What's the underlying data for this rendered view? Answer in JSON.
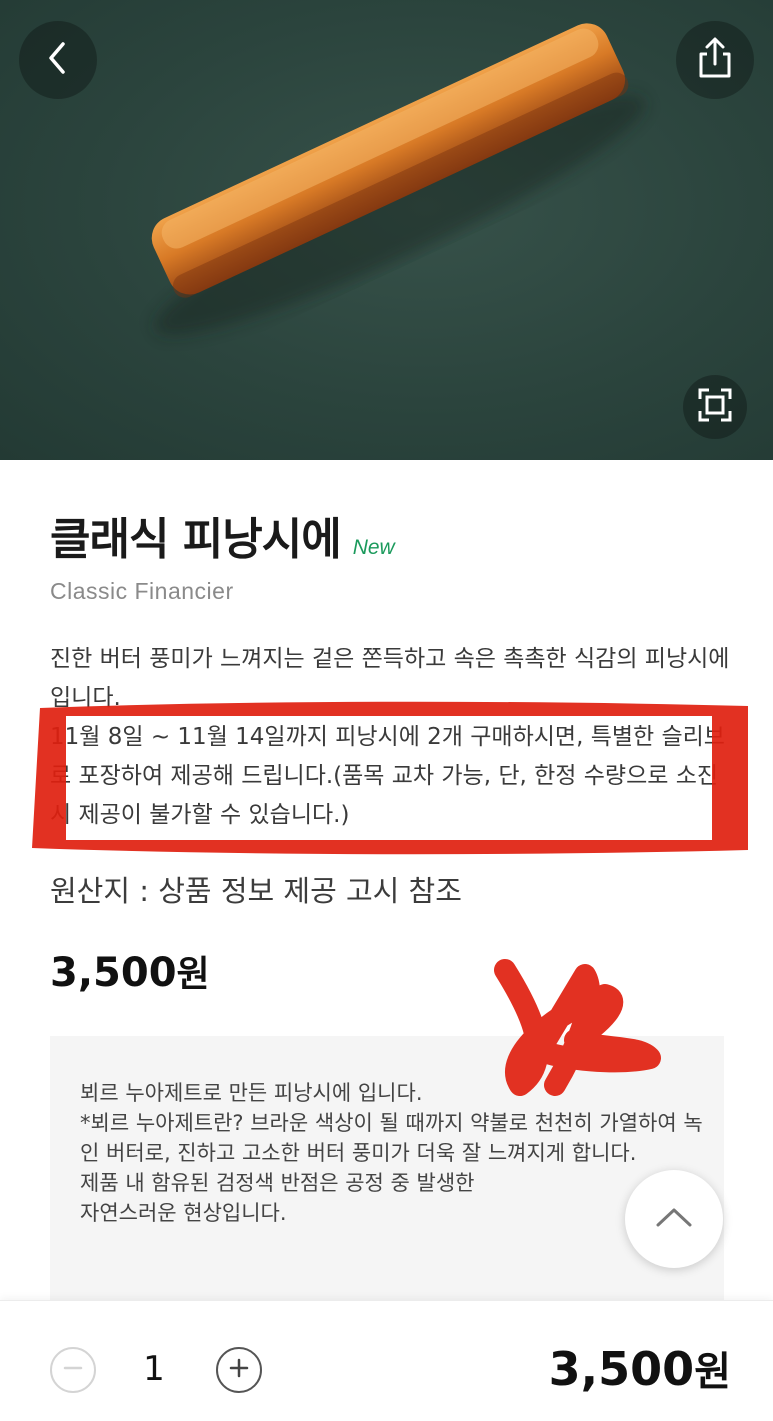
{
  "product": {
    "name": "클래식 피낭시에",
    "badge": "New",
    "english_name": "Classic Financier",
    "description": [
      "진한 버터 풍미가 느껴지는 겉은 쫀득하고 속은 촉촉한 식감의 피낭시에입니다.",
      "11월 8일 ~ 11월 14일까지 피낭시에 2개 구매하시면, 특별한 슬리브로 포장하여 제공해 드립니다.(품목 교차 가능, 단, 한정 수량으로 소진 시 제공이 불가할 수 있습니다.)"
    ],
    "origin": "원산지 : 상품 정보 제공 고시 참조",
    "price": "3,500",
    "currency": "원"
  },
  "notice": [
    "뵈르 누아제트로 만든 피낭시에 입니다.",
    "*뵈르 누아제트란? 브라운 색상이 될 때까지 약불로 천천히 가열하여 녹인 버터로, 진하고 고소한 버터 풍미가 더욱 잘 느껴지게 합니다.",
    "제품 내 함유된 검정색 반점은 공정 중 발생한",
    "자연스러운 현상입니다."
  ],
  "cart": {
    "quantity": "1",
    "total": "3,500",
    "currency": "원"
  },
  "icons": {
    "back": "chevron-left-icon",
    "share": "share-icon",
    "expand": "expand-icon",
    "scroll_top": "chevron-up-icon",
    "minus": "minus-icon",
    "plus": "plus-icon"
  },
  "colors": {
    "hero_background": "#2b443d",
    "new_badge": "#1b9a5c",
    "annotation": "#e0200f"
  }
}
